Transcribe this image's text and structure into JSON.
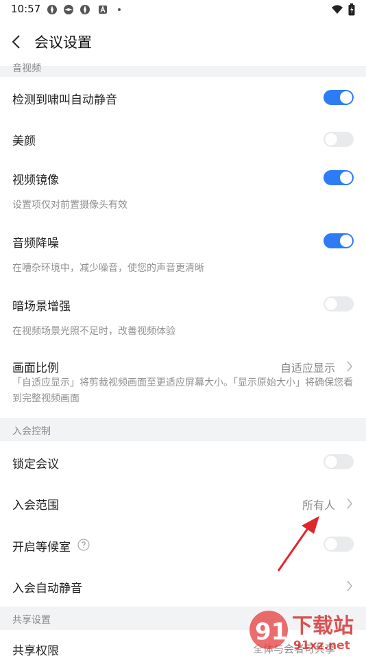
{
  "status": {
    "time": "10:57"
  },
  "header": {
    "title": "会议设置"
  },
  "sections": {
    "av": "音视频",
    "join": "入会控制",
    "share": "共享设置"
  },
  "rows": {
    "howl": {
      "label": "检测到啸叫自动静音",
      "state": "on"
    },
    "beauty": {
      "label": "美颜",
      "state": "off"
    },
    "mirror": {
      "label": "视频镜像",
      "state": "on",
      "desc": "设置项仅对前置摄像头有效"
    },
    "noise": {
      "label": "音频降噪",
      "state": "on",
      "desc": "在嘈杂环境中，减少噪音，使您的声音更清晰"
    },
    "lowlight": {
      "label": "暗场景增强",
      "state": "off",
      "desc": "在视频场景光照不足时，改善视频体验"
    },
    "ratio": {
      "label": "画面比例",
      "value": "自适应显示",
      "desc": "「自适应显示」将剪裁视频画面至更适应屏幕大小。「显示原始大小」将确保您看到完整视频画面"
    },
    "lock": {
      "label": "锁定会议",
      "state": "off"
    },
    "scope": {
      "label": "入会范围",
      "value": "所有人"
    },
    "waiting": {
      "label": "开启等候室",
      "state": "off"
    },
    "automute": {
      "label": "入会自动静音"
    },
    "sharePerm": {
      "label": "共享权限",
      "value": "全体与会者可共享"
    }
  },
  "watermark": {
    "text": "下载站",
    "url": "91xz.net"
  },
  "colors": {
    "accent": "#2d7cf6",
    "annotation": "#e0262b"
  }
}
